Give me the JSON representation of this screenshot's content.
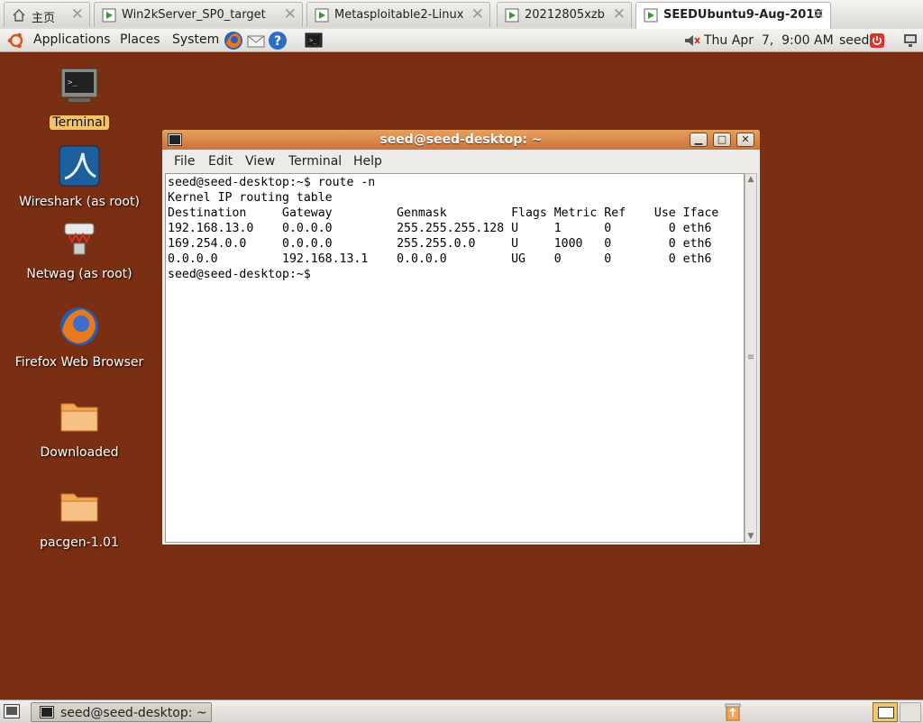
{
  "host_tabs": [
    {
      "label": "主页"
    },
    {
      "label": "Win2kServer_SP0_target"
    },
    {
      "label": "Metasploitable2-Linux"
    },
    {
      "label": "20212805xzb"
    },
    {
      "label": "SEEDUbuntu9-Aug-2010"
    }
  ],
  "top_panel": {
    "menus": [
      "Applications",
      "Places",
      "System"
    ],
    "clock": "Thu Apr  7,  9:00 AM",
    "user": "seed"
  },
  "desktop_icons": [
    {
      "label": "Terminal"
    },
    {
      "label": "Wireshark (as root)"
    },
    {
      "label": "Netwag (as root)"
    },
    {
      "label": "Firefox Web Browser"
    },
    {
      "label": "Downloaded"
    },
    {
      "label": "pacgen-1.01"
    }
  ],
  "terminal": {
    "title": "seed@seed-desktop: ~",
    "menu": [
      "File",
      "Edit",
      "View",
      "Terminal",
      "Help"
    ],
    "lines": [
      "seed@seed-desktop:~$ route -n",
      "Kernel IP routing table",
      "Destination     Gateway         Genmask         Flags Metric Ref    Use Iface",
      "192.168.13.0    0.0.0.0         255.255.255.128 U     1      0        0 eth6",
      "169.254.0.0     0.0.0.0         255.255.0.0     U     1000   0        0 eth6",
      "0.0.0.0         192.168.13.1    0.0.0.0         UG    0      0        0 eth6",
      "seed@seed-desktop:~$ "
    ]
  },
  "bottom_panel": {
    "task_label": "seed@seed-desktop: ~"
  }
}
